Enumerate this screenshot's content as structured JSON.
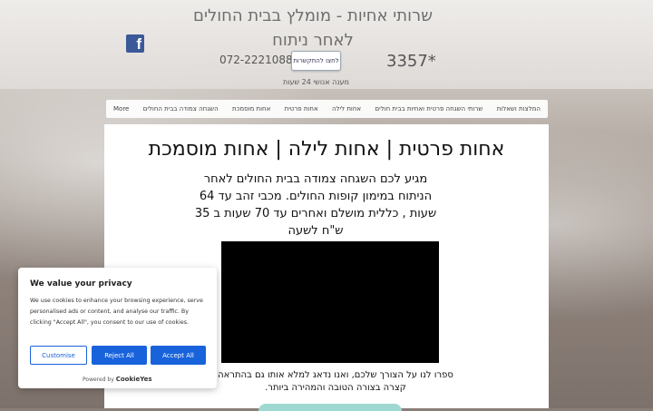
{
  "header": {
    "title": "שרותי אחיות - מומלץ בבית החולים לאחר ניתוח",
    "phone": "072-2221088",
    "contact_button": "לחצו להתקשרות",
    "ext_code": "3357*",
    "availability": "מענה אנושי 24 שעות",
    "facebook_letter": "f"
  },
  "nav": {
    "items": [
      "המלצות ושאלות",
      "שרותי השגחה פרטית ואחיות בבית חולים",
      "אחות לילה",
      "אחות פרטית",
      "אחות מוסמכת",
      "השגחה צמודה בבית החולים",
      "More"
    ]
  },
  "main": {
    "headline": "אחות פרטית | אחות לילה | אחות מוסמכת",
    "paragraph": "מגיע לכם השגחה צמודה בבית החולים לאחר הניתוח במימון קופות החולים. מכבי זהב עד 64 שעות , כללית   מושלם ואחרים עד 70 שעות ב 35 ש\"ח לשעה",
    "bottom_text": "ספרו לנו על הצורך שלכם, ואנו נדאג למלא אותו גם בהתראה קצרה בצורה הטובה והמהירה ביותר."
  },
  "cookie": {
    "title": "We value your privacy",
    "body": "We use cookies to enhance your browsing experience, serve personalised ads or content, and analyse our traffic. By clicking \"Accept All\", you consent to our use of cookies.",
    "customise": "Customise",
    "reject": "Reject All",
    "accept": "Accept All",
    "powered_by": "Powered by",
    "brand": "CookieYes"
  },
  "colors": {
    "accent": "#1863dc",
    "facebook": "#3b5998",
    "cta": "#9fd8d1"
  }
}
